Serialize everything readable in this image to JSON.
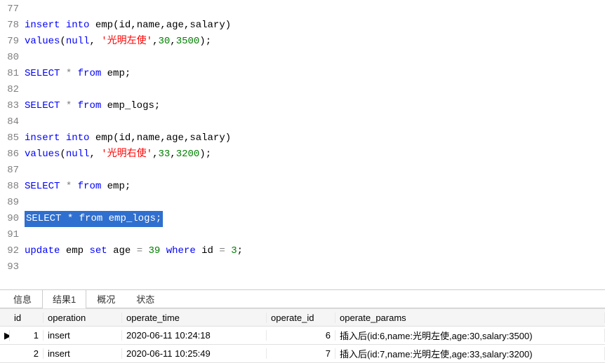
{
  "editor": {
    "lines": [
      {
        "n": 77,
        "tokens": []
      },
      {
        "n": 78,
        "tokens": [
          {
            "t": "kw",
            "v": "insert"
          },
          {
            "t": "sp"
          },
          {
            "t": "kw",
            "v": "into"
          },
          {
            "t": "sp"
          },
          {
            "t": "ident",
            "v": "emp"
          },
          {
            "t": "punct",
            "v": "("
          },
          {
            "t": "ident",
            "v": "id"
          },
          {
            "t": "punct",
            "v": ","
          },
          {
            "t": "ident",
            "v": "name"
          },
          {
            "t": "punct",
            "v": ","
          },
          {
            "t": "ident",
            "v": "age"
          },
          {
            "t": "punct",
            "v": ","
          },
          {
            "t": "ident",
            "v": "salary"
          },
          {
            "t": "punct",
            "v": ")"
          }
        ]
      },
      {
        "n": 79,
        "tokens": [
          {
            "t": "kw",
            "v": "values"
          },
          {
            "t": "punct",
            "v": "("
          },
          {
            "t": "kw",
            "v": "null"
          },
          {
            "t": "punct",
            "v": ","
          },
          {
            "t": "sp"
          },
          {
            "t": "str",
            "v": "'光明左使'"
          },
          {
            "t": "punct",
            "v": ","
          },
          {
            "t": "num",
            "v": "30"
          },
          {
            "t": "punct",
            "v": ","
          },
          {
            "t": "num",
            "v": "3500"
          },
          {
            "t": "punct",
            "v": ")"
          },
          {
            "t": "punct",
            "v": ";"
          }
        ]
      },
      {
        "n": 80,
        "tokens": []
      },
      {
        "n": 81,
        "tokens": [
          {
            "t": "kw",
            "v": "SELECT"
          },
          {
            "t": "sp"
          },
          {
            "t": "op",
            "v": "*"
          },
          {
            "t": "sp"
          },
          {
            "t": "kw",
            "v": "from"
          },
          {
            "t": "sp"
          },
          {
            "t": "ident",
            "v": "emp"
          },
          {
            "t": "punct",
            "v": ";"
          }
        ]
      },
      {
        "n": 82,
        "tokens": []
      },
      {
        "n": 83,
        "tokens": [
          {
            "t": "kw",
            "v": "SELECT"
          },
          {
            "t": "sp"
          },
          {
            "t": "op",
            "v": "*"
          },
          {
            "t": "sp"
          },
          {
            "t": "kw",
            "v": "from"
          },
          {
            "t": "sp"
          },
          {
            "t": "ident",
            "v": "emp_logs"
          },
          {
            "t": "punct",
            "v": ";"
          }
        ]
      },
      {
        "n": 84,
        "tokens": []
      },
      {
        "n": 85,
        "tokens": [
          {
            "t": "kw",
            "v": "insert"
          },
          {
            "t": "sp"
          },
          {
            "t": "kw",
            "v": "into"
          },
          {
            "t": "sp"
          },
          {
            "t": "ident",
            "v": "emp"
          },
          {
            "t": "punct",
            "v": "("
          },
          {
            "t": "ident",
            "v": "id"
          },
          {
            "t": "punct",
            "v": ","
          },
          {
            "t": "ident",
            "v": "name"
          },
          {
            "t": "punct",
            "v": ","
          },
          {
            "t": "ident",
            "v": "age"
          },
          {
            "t": "punct",
            "v": ","
          },
          {
            "t": "ident",
            "v": "salary"
          },
          {
            "t": "punct",
            "v": ")"
          }
        ]
      },
      {
        "n": 86,
        "tokens": [
          {
            "t": "kw",
            "v": "values"
          },
          {
            "t": "punct",
            "v": "("
          },
          {
            "t": "kw",
            "v": "null"
          },
          {
            "t": "punct",
            "v": ","
          },
          {
            "t": "sp"
          },
          {
            "t": "str",
            "v": "'光明右使'"
          },
          {
            "t": "punct",
            "v": ","
          },
          {
            "t": "num",
            "v": "33"
          },
          {
            "t": "punct",
            "v": ","
          },
          {
            "t": "num",
            "v": "3200"
          },
          {
            "t": "punct",
            "v": ")"
          },
          {
            "t": "punct",
            "v": ";"
          }
        ]
      },
      {
        "n": 87,
        "tokens": []
      },
      {
        "n": 88,
        "tokens": [
          {
            "t": "kw",
            "v": "SELECT"
          },
          {
            "t": "sp"
          },
          {
            "t": "op",
            "v": "*"
          },
          {
            "t": "sp"
          },
          {
            "t": "kw",
            "v": "from"
          },
          {
            "t": "sp"
          },
          {
            "t": "ident",
            "v": "emp"
          },
          {
            "t": "punct",
            "v": ";"
          }
        ]
      },
      {
        "n": 89,
        "tokens": []
      },
      {
        "n": 90,
        "selected": true,
        "tokens": [
          {
            "t": "kw",
            "v": "SELECT"
          },
          {
            "t": "sp"
          },
          {
            "t": "op",
            "v": "*"
          },
          {
            "t": "sp"
          },
          {
            "t": "kw",
            "v": "from"
          },
          {
            "t": "sp"
          },
          {
            "t": "ident",
            "v": "emp_logs"
          },
          {
            "t": "punct",
            "v": ";"
          }
        ]
      },
      {
        "n": 91,
        "tokens": []
      },
      {
        "n": 92,
        "tokens": [
          {
            "t": "kw",
            "v": "update"
          },
          {
            "t": "sp"
          },
          {
            "t": "ident",
            "v": "emp"
          },
          {
            "t": "sp"
          },
          {
            "t": "kw",
            "v": "set"
          },
          {
            "t": "sp"
          },
          {
            "t": "ident",
            "v": "age"
          },
          {
            "t": "sp"
          },
          {
            "t": "op",
            "v": "="
          },
          {
            "t": "sp"
          },
          {
            "t": "num",
            "v": "39"
          },
          {
            "t": "sp"
          },
          {
            "t": "kw",
            "v": "where"
          },
          {
            "t": "sp"
          },
          {
            "t": "ident",
            "v": "id"
          },
          {
            "t": "sp"
          },
          {
            "t": "op",
            "v": "="
          },
          {
            "t": "sp"
          },
          {
            "t": "num",
            "v": "3"
          },
          {
            "t": "punct",
            "v": ";"
          }
        ]
      },
      {
        "n": 93,
        "tokens": []
      }
    ]
  },
  "tabs": {
    "items": [
      {
        "label": "信息",
        "active": false
      },
      {
        "label": "结果1",
        "active": true
      },
      {
        "label": "概况",
        "active": false
      },
      {
        "label": "状态",
        "active": false
      }
    ]
  },
  "result": {
    "columns": {
      "id": "id",
      "operation": "operation",
      "operate_time": "operate_time",
      "operate_id": "operate_id",
      "operate_params": "operate_params"
    },
    "rows": [
      {
        "marker": "▶",
        "id": "1",
        "operation": "insert",
        "operate_time": "2020-06-11 10:24:18",
        "operate_id": "6",
        "operate_params": "插入后(id:6,name:光明左使,age:30,salary:3500)"
      },
      {
        "marker": "",
        "id": "2",
        "operation": "insert",
        "operate_time": "2020-06-11 10:25:49",
        "operate_id": "7",
        "operate_params": "插入后(id:7,name:光明左使,age:33,salary:3200)"
      }
    ]
  }
}
